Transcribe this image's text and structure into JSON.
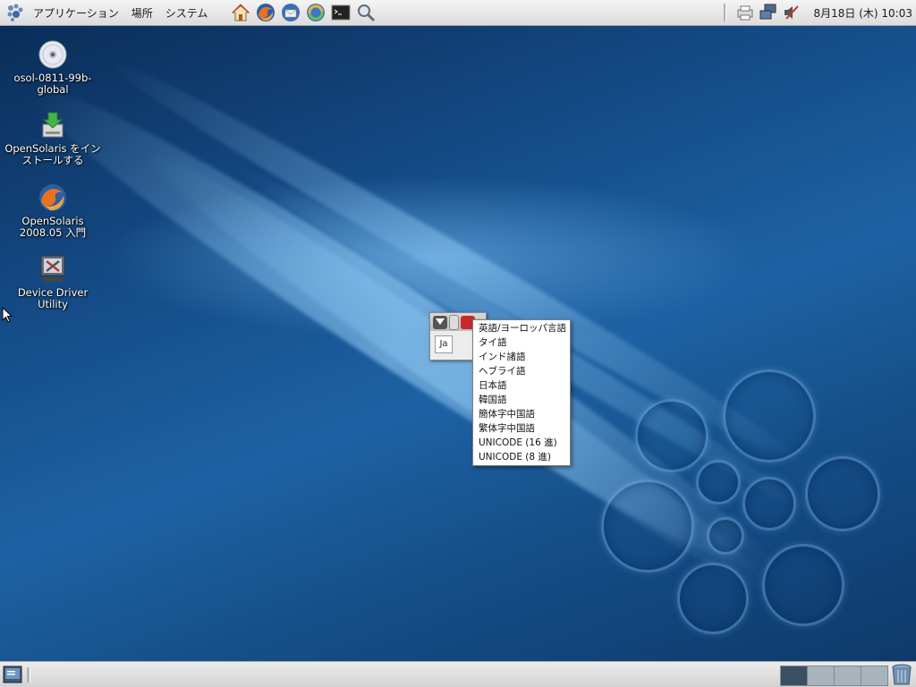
{
  "top_panel": {
    "menus": [
      {
        "label": "アプリケーション"
      },
      {
        "label": "場所"
      },
      {
        "label": "システム"
      }
    ],
    "launchers": [
      "home-icon",
      "firefox-icon",
      "thunderbird-icon",
      "update-manager-icon",
      "terminal-icon",
      "search-icon"
    ],
    "tray": [
      "network-printer-icon",
      "network-icon",
      "volume-muted-icon"
    ],
    "clock": "8月18日 (木) 10:03"
  },
  "desktop_icons": [
    {
      "label": "osol-0811-99b-global",
      "icon": "cd-disc-icon"
    },
    {
      "label": "OpenSolaris をインストールする",
      "icon": "install-icon"
    },
    {
      "label": "OpenSolaris 2008.05 入門",
      "icon": "firefox-icon"
    },
    {
      "label": "Device Driver Utility",
      "icon": "device-driver-icon"
    }
  ],
  "im_window": {
    "field_value": "Ja"
  },
  "language_menu": {
    "items": [
      "英語/ヨーロッパ言語",
      "タイ語",
      "インド諸語",
      "ヘブライ語",
      "日本語",
      "韓国語",
      "簡体字中国語",
      "繁体字中国語",
      "UNICODE (16 進)",
      "UNICODE (8 進)"
    ]
  },
  "bottom_panel": {
    "workspaces": 4,
    "active_workspace": 1
  },
  "colors": {
    "wallpaper": "#164f8c",
    "panel": "#e6e6e6",
    "active_workspace": "#3b4f63"
  }
}
